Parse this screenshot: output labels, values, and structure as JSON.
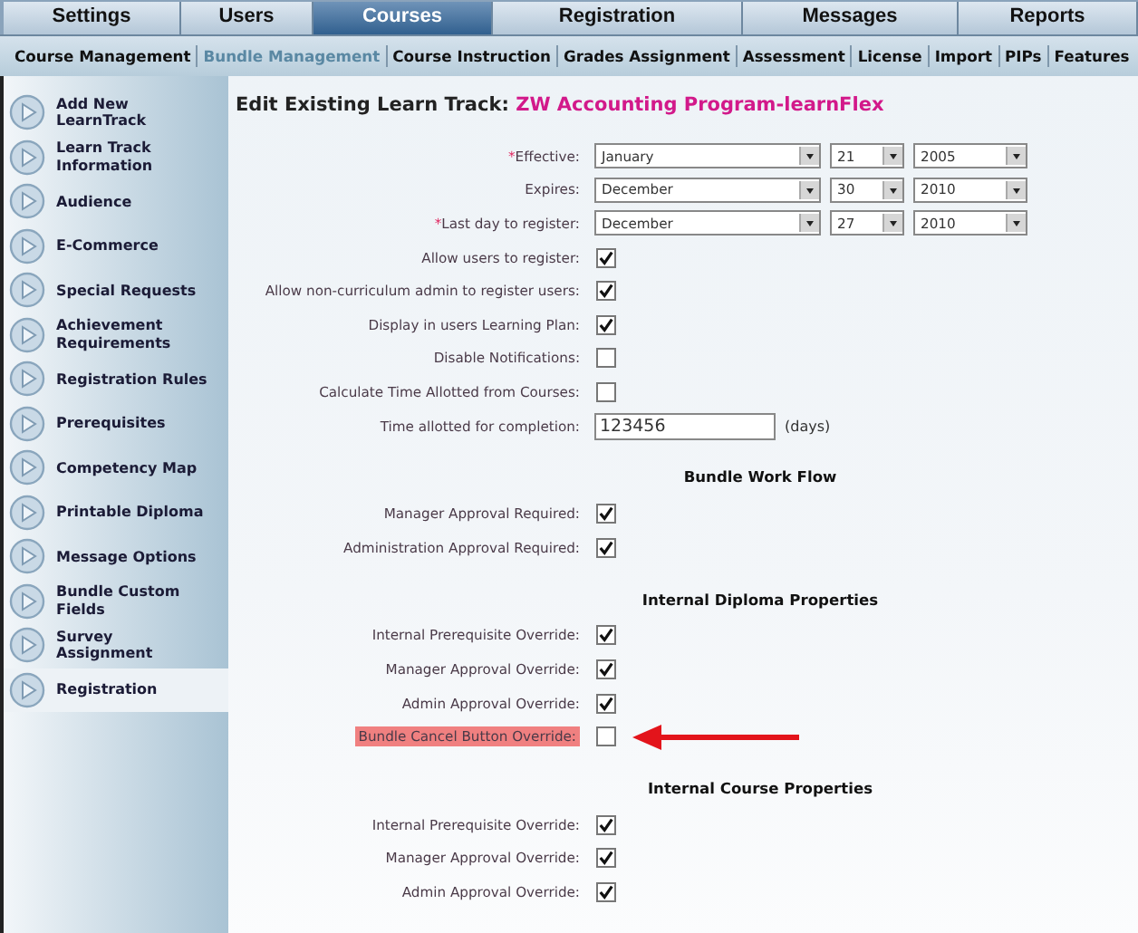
{
  "tabs": [
    {
      "label": "Settings",
      "selected": false
    },
    {
      "label": "Users",
      "selected": false
    },
    {
      "label": "Courses",
      "selected": true
    },
    {
      "label": "Registration",
      "selected": false
    },
    {
      "label": "Messages",
      "selected": false
    },
    {
      "label": "Reports",
      "selected": false
    }
  ],
  "subtabs": [
    {
      "label": "Course Management",
      "selected": false
    },
    {
      "label": "Bundle Management",
      "selected": true
    },
    {
      "label": "Course Instruction",
      "selected": false
    },
    {
      "label": "Grades Assignment",
      "selected": false
    },
    {
      "label": "Assessment",
      "selected": false
    },
    {
      "label": "License",
      "selected": false
    },
    {
      "label": "Import",
      "selected": false
    },
    {
      "label": "PIPs",
      "selected": false
    },
    {
      "label": "Features",
      "selected": false
    }
  ],
  "sidebar": {
    "items": [
      {
        "label": "Add New LearnTrack",
        "selected": false
      },
      {
        "label": "Learn Track Information",
        "selected": false
      },
      {
        "label": "Audience",
        "selected": false
      },
      {
        "label": "E-Commerce",
        "selected": false
      },
      {
        "label": "Special Requests",
        "selected": false
      },
      {
        "label": "Achievement Requirements",
        "selected": false
      },
      {
        "label": "Registration Rules",
        "selected": false
      },
      {
        "label": "Prerequisites",
        "selected": false
      },
      {
        "label": "Competency Map",
        "selected": false
      },
      {
        "label": "Printable Diploma",
        "selected": false
      },
      {
        "label": "Message Options",
        "selected": false
      },
      {
        "label": "Bundle Custom Fields",
        "selected": false
      },
      {
        "label": "Survey Assignment",
        "selected": false
      },
      {
        "label": "Registration",
        "selected": true
      }
    ]
  },
  "page": {
    "title": "Edit Existing Learn Track:",
    "name": "ZW Accounting Program-learnFlex"
  },
  "sections": [
    {
      "rows": [
        {
          "kind": "date",
          "label": "Effective:",
          "marker": "*",
          "month": "January",
          "day": "21",
          "year": "2005"
        },
        {
          "kind": "date",
          "label": "Expires:",
          "month": "December",
          "day": "30",
          "year": "2010"
        },
        {
          "kind": "date",
          "label": "Last day to register:",
          "marker": "*",
          "month": "December",
          "day": "27",
          "year": "2010"
        },
        {
          "kind": "checkbox",
          "label": "Allow users to register:",
          "checked": true,
          "highlighted": false
        },
        {
          "kind": "checkbox",
          "label": "Allow non-curriculum admin to register users:",
          "checked": true,
          "highlighted": false
        },
        {
          "kind": "checkbox",
          "label": "Display in users Learning Plan:",
          "checked": true,
          "highlighted": false
        },
        {
          "kind": "checkbox",
          "label": "Disable Notifications:",
          "checked": false,
          "highlighted": false
        },
        {
          "kind": "checkbox",
          "label": "Calculate Time Allotted from Courses:",
          "checked": false,
          "highlighted": false
        },
        {
          "kind": "text",
          "label": "Time allotted for completion:",
          "value": "123456",
          "unit": "(days)"
        }
      ]
    },
    {
      "heading": "Bundle Work Flow",
      "rows": [
        {
          "kind": "checkbox",
          "label": "Manager Approval Required:",
          "checked": true,
          "highlighted": false
        },
        {
          "kind": "checkbox",
          "label": "Administration Approval Required:",
          "checked": true,
          "highlighted": false
        }
      ]
    },
    {
      "heading": "Internal Diploma Properties",
      "rows": [
        {
          "kind": "checkbox",
          "label": "Internal Prerequisite Override:",
          "checked": true,
          "highlighted": false
        },
        {
          "kind": "checkbox",
          "label": "Manager Approval Override:",
          "checked": true,
          "highlighted": false
        },
        {
          "kind": "checkbox",
          "label": "Admin Approval Override:",
          "checked": true,
          "highlighted": false
        },
        {
          "kind": "checkbox",
          "label": "Bundle Cancel Button Override:",
          "checked": false,
          "highlighted": true
        }
      ]
    },
    {
      "heading": "Internal Course Properties",
      "rows": [
        {
          "kind": "checkbox",
          "label": "Internal Prerequisite Override:",
          "checked": true,
          "highlighted": false
        },
        {
          "kind": "checkbox",
          "label": "Manager Approval Override:",
          "checked": true,
          "highlighted": false
        },
        {
          "kind": "checkbox",
          "label": "Admin Approval Override:",
          "checked": true,
          "highlighted": false
        }
      ]
    }
  ]
}
